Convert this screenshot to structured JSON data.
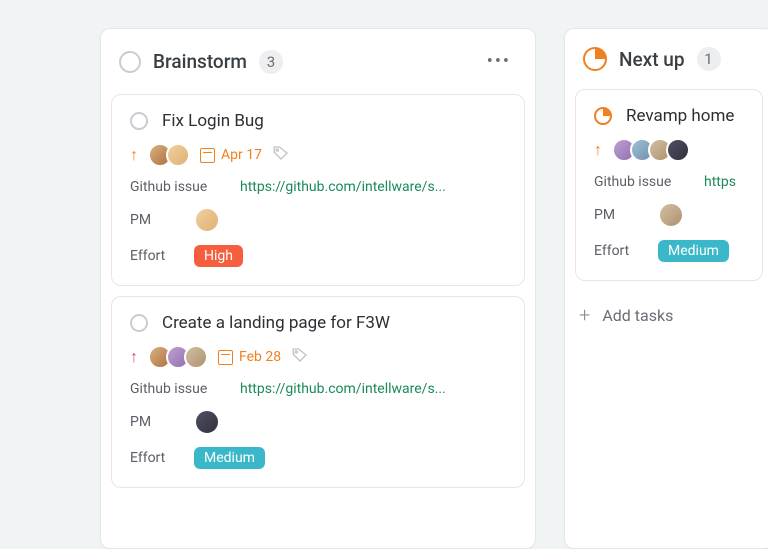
{
  "columns": [
    {
      "title": "Brainstorm",
      "count": "3",
      "status_icon": "circle",
      "cards": [
        {
          "title": "Fix Login Bug",
          "priority_color": "orange",
          "date": "Apr 17",
          "github_label": "Github issue",
          "github_url": "https://github.com/intellware/s...",
          "pm_label": "PM",
          "effort_label": "Effort",
          "effort_value": "High",
          "effort_class": "high",
          "avatars": [
            "a1",
            "a2"
          ]
        },
        {
          "title": "Create a landing page for F3W",
          "priority_color": "pink",
          "date": "Feb 28",
          "github_label": "Github issue",
          "github_url": "https://github.com/intellware/s...",
          "pm_label": "PM",
          "effort_label": "Effort",
          "effort_value": "Medium",
          "effort_class": "medium",
          "avatars": [
            "a1",
            "a3",
            "a6"
          ]
        }
      ]
    },
    {
      "title": "Next up",
      "count": "1",
      "status_icon": "pie",
      "add_label": "Add tasks",
      "cards": [
        {
          "title": "Revamp home",
          "priority_color": "orange",
          "date": "",
          "github_label": "Github issue",
          "github_url": "https",
          "pm_label": "PM",
          "effort_label": "Effort",
          "effort_value": "Medium",
          "effort_class": "medium",
          "avatars": [
            "a3",
            "a4",
            "a6",
            "a5"
          ]
        }
      ]
    }
  ]
}
